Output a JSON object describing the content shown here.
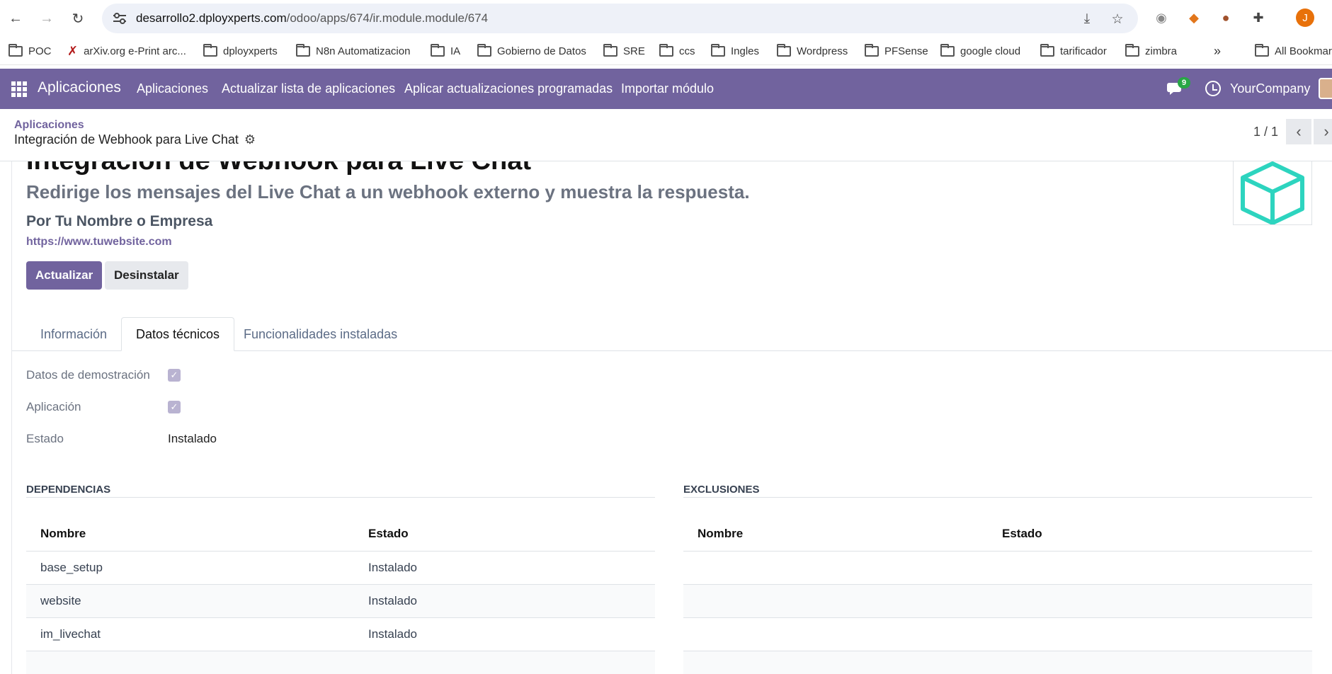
{
  "browser": {
    "url_host": "desarrollo2.dployxperts.com",
    "url_path": "/odoo/apps/674/ir.module.module/674",
    "profile_initial": "J",
    "bookmarks": [
      "POC",
      "arXiv.org e-Print arc...",
      "dployxperts",
      "N8n Automatizacion",
      "IA",
      "Gobierno de Datos",
      "SRE",
      "ccs",
      "Ingles",
      "Wordpress",
      "PFSense",
      "google cloud",
      "tarificador",
      "zimbra"
    ],
    "more_bookmarks": "»",
    "all_bookmarks": "All Bookmar"
  },
  "navbar": {
    "brand": "Aplicaciones",
    "menu": [
      "Aplicaciones",
      "Actualizar lista de aplicaciones",
      "Aplicar actualizaciones programadas",
      "Importar módulo"
    ],
    "chat_badge": "9",
    "company": "YourCompany"
  },
  "control_panel": {
    "breadcrumb_parent": "Aplicaciones",
    "breadcrumb_current": "Integración de Webhook para Live Chat",
    "pager": "1 / 1"
  },
  "module": {
    "title": "Integración de Webhook para Live Chat",
    "summary": "Redirige los mensajes del Live Chat a un webhook externo y muestra la respuesta.",
    "author": "Por Tu Nombre o Empresa",
    "website": "https://www.tuwebsite.com",
    "btn_update": "Actualizar",
    "btn_uninstall": "Desinstalar",
    "icon_color": "#2dd4bf"
  },
  "tabs": [
    "Información",
    "Datos técnicos",
    "Funcionalidades instaladas"
  ],
  "active_tab": "Datos técnicos",
  "technical": {
    "demo_label": "Datos de demostración",
    "demo_checked": true,
    "app_label": "Aplicación",
    "app_checked": true,
    "state_label": "Estado",
    "state_value": "Instalado"
  },
  "dependencies": {
    "title": "DEPENDENCIAS",
    "col_name": "Nombre",
    "col_state": "Estado",
    "rows": [
      {
        "name": "base_setup",
        "state": "Instalado"
      },
      {
        "name": "website",
        "state": "Instalado"
      },
      {
        "name": "im_livechat",
        "state": "Instalado"
      }
    ]
  },
  "exclusions": {
    "title": "EXCLUSIONES",
    "col_name": "Nombre",
    "col_state": "Estado"
  },
  "colors": {
    "odoo_primary": "#71639e",
    "chat_badge": "#28a745"
  }
}
